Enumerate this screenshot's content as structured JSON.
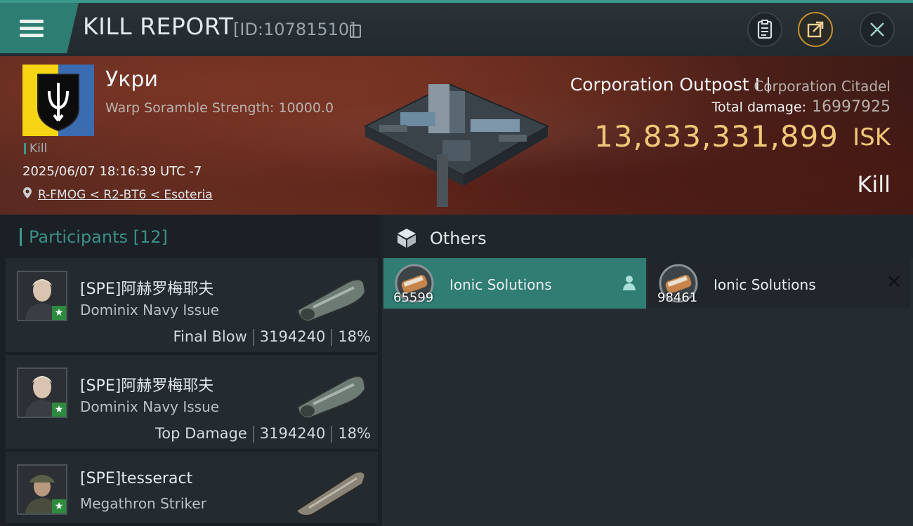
{
  "header": {
    "title": "KILL REPORT",
    "id_text": "[ID:10781510]"
  },
  "victim": {
    "name": "Укри",
    "warp_scramble": "Warp Soramble Strength: 10000.0",
    "kill_tag": "Kill",
    "datetime": "2025/06/07 18:16:39 UTC -7",
    "location": "R-FMOG < R2-BT6 < Esoteria"
  },
  "target": {
    "ship_name": "Corporation Outpost I",
    "ship_type": "Corporation Citadel",
    "total_damage_label": "Total damage:",
    "total_damage": "16997925",
    "isk_value": "13,833,331,899",
    "isk_unit": "ISK",
    "result": "Kill"
  },
  "participants": {
    "title": "Participants",
    "count": "[12]",
    "items": [
      {
        "name": "[SPE]阿赫罗梅耶夫",
        "ship": "Dominix Navy Issue",
        "label": "Final Blow",
        "damage": "3194240",
        "percent": "18%"
      },
      {
        "name": "[SPE]阿赫罗梅耶夫",
        "ship": "Dominix Navy Issue",
        "label": "Top Damage",
        "damage": "3194240",
        "percent": "18%"
      },
      {
        "name": "[SPE]tesseract",
        "ship": "Megathron Striker",
        "label": "",
        "damage": "",
        "percent": ""
      }
    ]
  },
  "others": {
    "title": "Others",
    "items": [
      {
        "name": "Ionic Solutions",
        "qty": "65599",
        "icon": "person-icon"
      },
      {
        "name": "Ionic Solutions",
        "qty": "98461",
        "icon": "close-icon"
      }
    ]
  },
  "colors": {
    "accent": "#3a9a8c",
    "isk": "#f0c878",
    "selected": "#2f7d73"
  }
}
